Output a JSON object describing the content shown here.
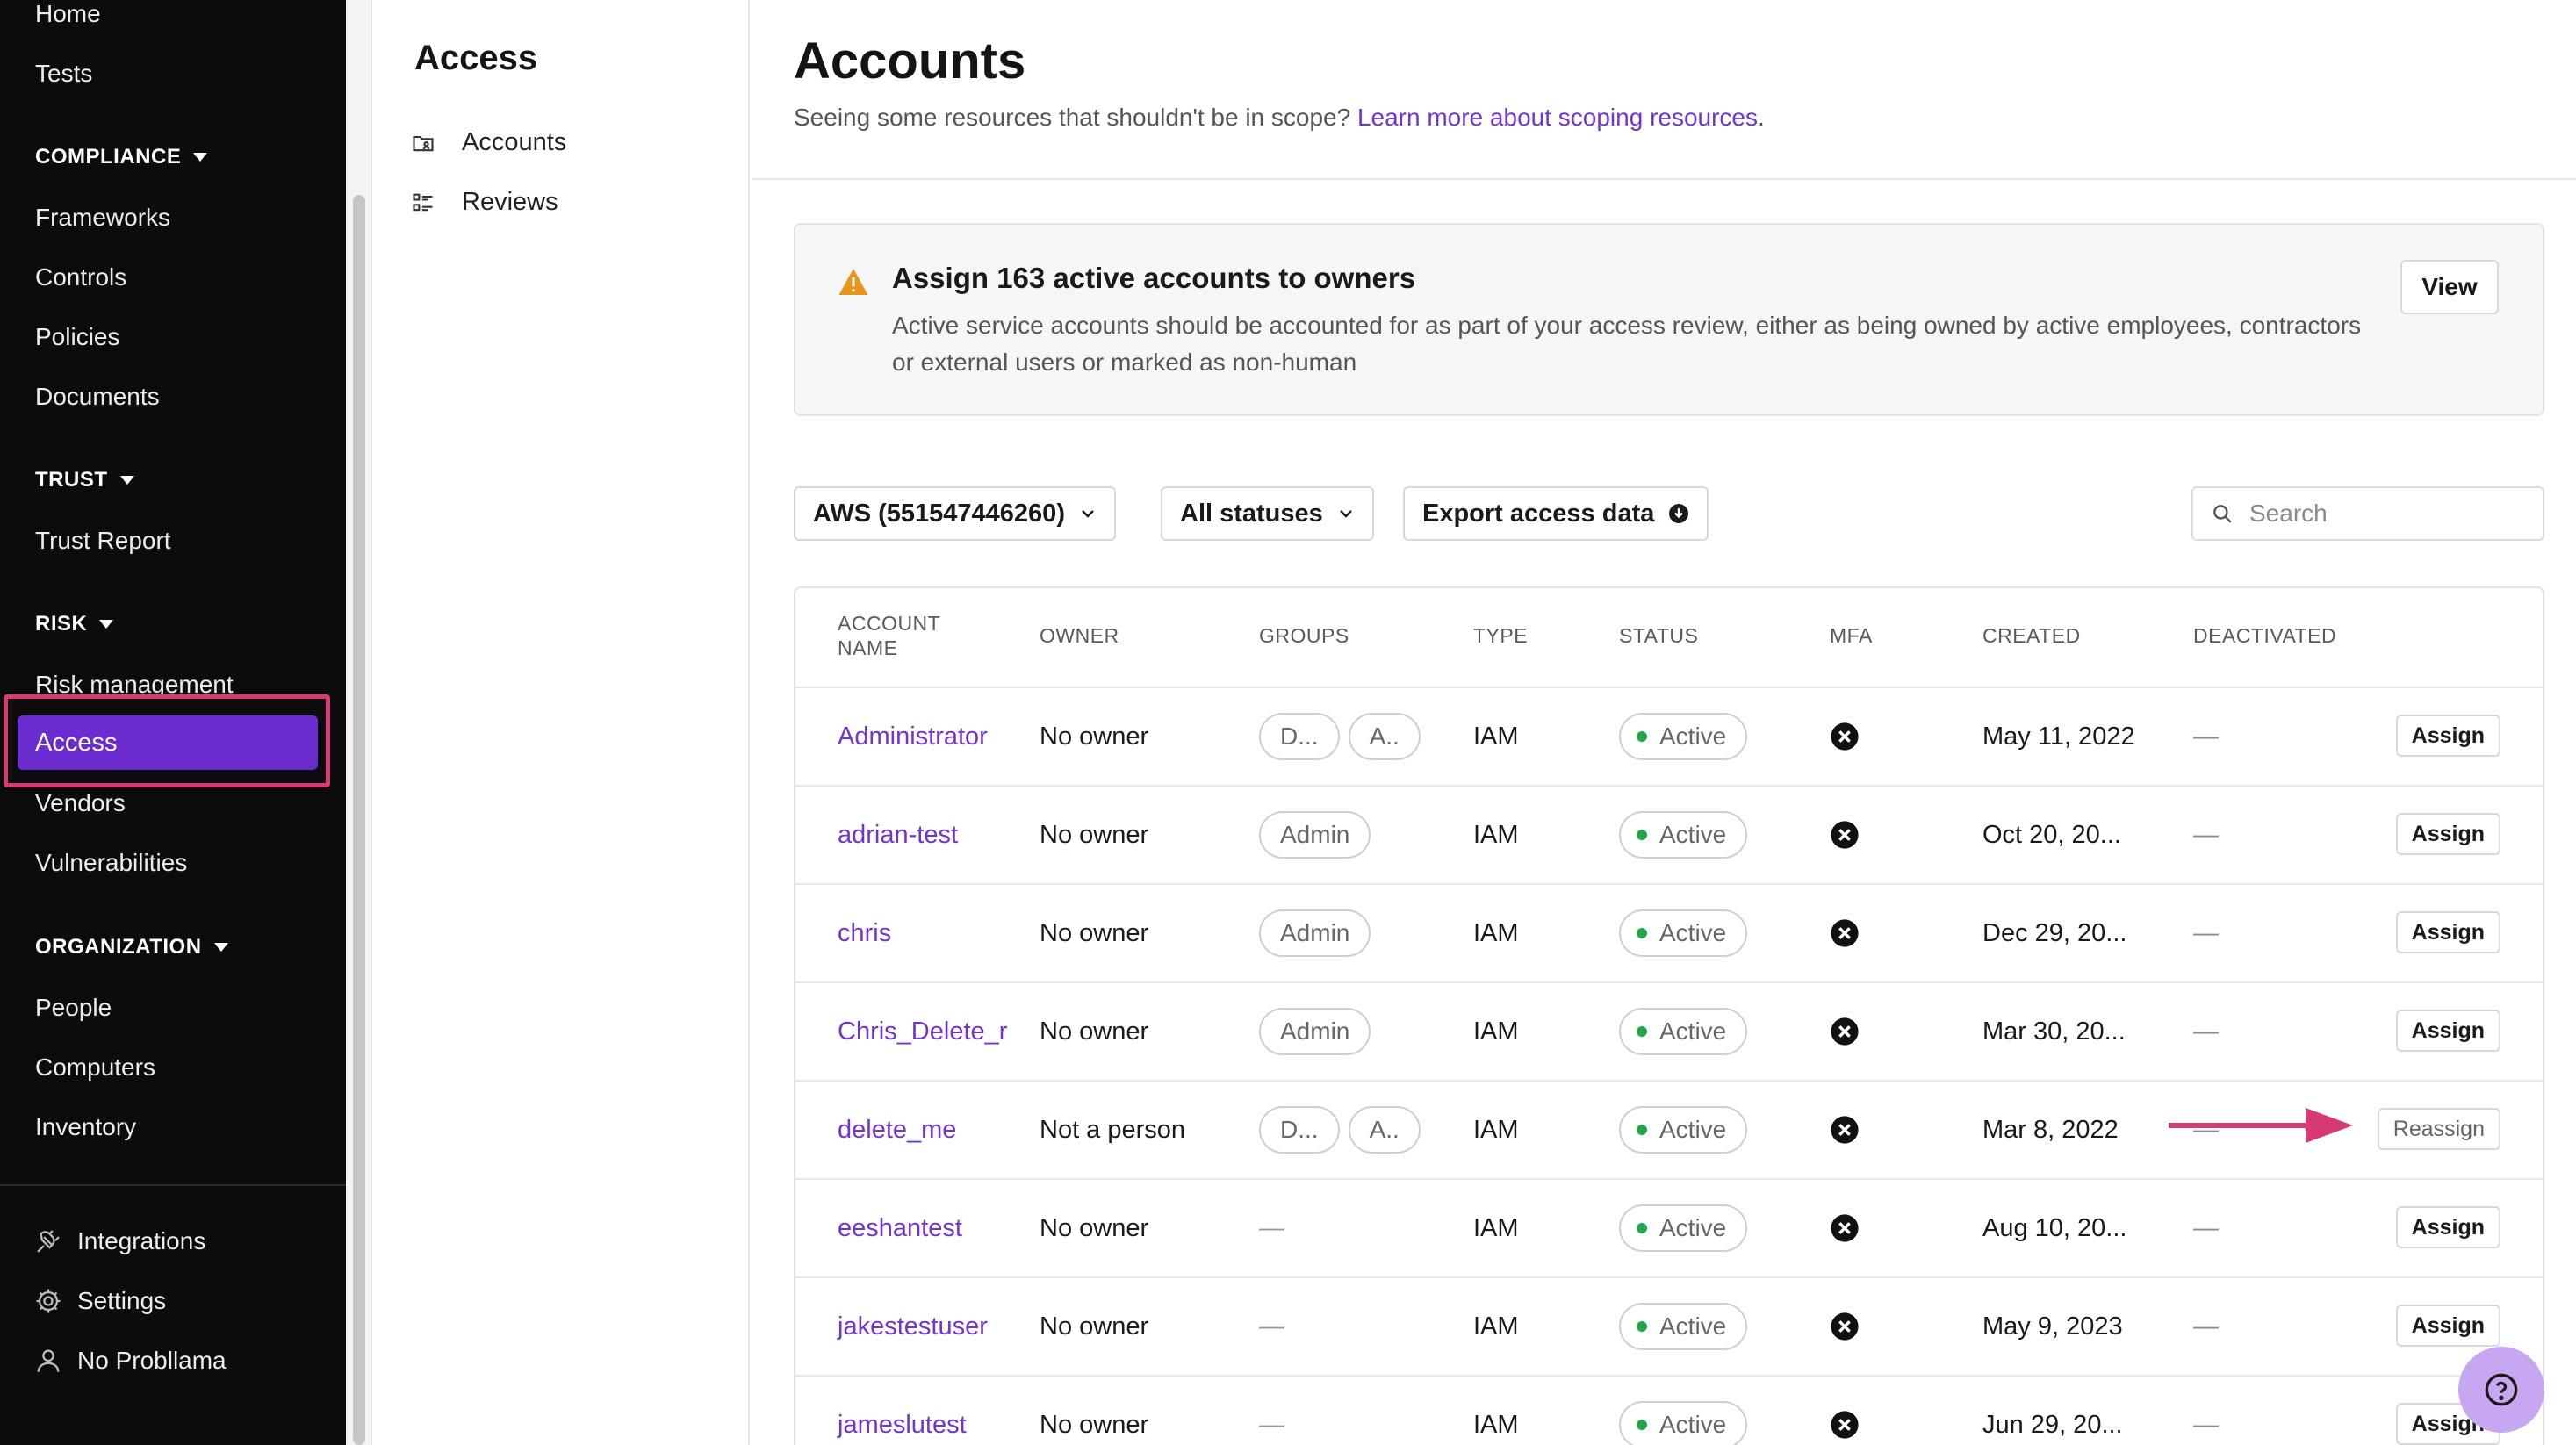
{
  "left_nav": {
    "top_links": [
      "Home",
      "Tests"
    ],
    "sections": [
      {
        "title": "COMPLIANCE",
        "items": [
          "Frameworks",
          "Controls",
          "Policies",
          "Documents"
        ]
      },
      {
        "title": "TRUST",
        "items": [
          "Trust Report"
        ]
      },
      {
        "title": "RISK",
        "items": [
          "Risk management",
          "Access",
          "Vendors",
          "Vulnerabilities"
        ]
      },
      {
        "title": "ORGANIZATION",
        "items": [
          "People",
          "Computers",
          "Inventory"
        ]
      }
    ],
    "active_item": "Access",
    "bottom_links": [
      {
        "label": "Integrations",
        "icon": "plug-icon"
      },
      {
        "label": "Settings",
        "icon": "gear-icon"
      },
      {
        "label": "No Probllama",
        "icon": "user-icon"
      }
    ],
    "accent_color": "#6a2ccf",
    "highlight_color": "#d63b76"
  },
  "sub_nav": {
    "title": "Access",
    "items": [
      {
        "label": "Accounts",
        "icon": "folder-user-icon"
      },
      {
        "label": "Reviews",
        "icon": "checklist-icon"
      }
    ]
  },
  "header": {
    "title": "Accounts",
    "subtitle_prefix": "Seeing some resources that shouldn't be in scope?",
    "subtitle_link": "Learn more about scoping resources",
    "subtitle_suffix": "."
  },
  "banner": {
    "icon": "warning-icon",
    "title": "Assign 163 active accounts to owners",
    "body": "Active service accounts should be accounted for as part of your access review, either as being owned by active employees, contractors or external users or marked as non-human",
    "button": "View"
  },
  "filters": {
    "account_select": "AWS (551547446260)",
    "status_select": "All statuses",
    "export_button": "Export access data",
    "search_placeholder": "Search"
  },
  "table": {
    "headers": {
      "account_name": "ACCOUNT NAME",
      "owner": "OWNER",
      "groups": "GROUPS",
      "type": "TYPE",
      "status": "STATUS",
      "mfa": "MFA",
      "created": "CREATED",
      "deactivated": "DEACTIVATED"
    },
    "rows": [
      {
        "name": "Administrator",
        "owner": "No owner",
        "groups": [
          "D...",
          "A.."
        ],
        "type": "IAM",
        "status": "Active",
        "created": "May 11, 2022",
        "deactivated": "—",
        "action": "Assign"
      },
      {
        "name": "adrian-test",
        "owner": "No owner",
        "groups": [
          "Admin"
        ],
        "type": "IAM",
        "status": "Active",
        "created": "Oct 20, 20...",
        "deactivated": "—",
        "action": "Assign"
      },
      {
        "name": "chris",
        "owner": "No owner",
        "groups": [
          "Admin"
        ],
        "type": "IAM",
        "status": "Active",
        "created": "Dec 29, 20...",
        "deactivated": "—",
        "action": "Assign"
      },
      {
        "name": "Chris_Delete_r",
        "owner": "No owner",
        "groups": [
          "Admin"
        ],
        "type": "IAM",
        "status": "Active",
        "created": "Mar 30, 20...",
        "deactivated": "—",
        "action": "Assign"
      },
      {
        "name": "delete_me",
        "owner": "Not a person",
        "groups": [
          "D...",
          "A.."
        ],
        "type": "IAM",
        "status": "Active",
        "created": "Mar 8, 2022",
        "deactivated": "—",
        "action": "Reassign"
      },
      {
        "name": "eeshantest",
        "owner": "No owner",
        "groups": [],
        "groups_empty": "—",
        "type": "IAM",
        "status": "Active",
        "created": "Aug 10, 20...",
        "deactivated": "—",
        "action": "Assign"
      },
      {
        "name": "jakestestuser",
        "owner": "No owner",
        "groups": [],
        "groups_empty": "—",
        "type": "IAM",
        "status": "Active",
        "created": "May 9, 2023",
        "deactivated": "—",
        "action": "Assign"
      },
      {
        "name": "jameslutest",
        "owner": "No owner",
        "groups": [],
        "groups_empty": "—",
        "type": "IAM",
        "status": "Active",
        "created": "Jun 29, 20...",
        "deactivated": "—",
        "action": "Assign"
      }
    ],
    "mfa_icon": "x-circle-icon",
    "status_color": "#22a84a",
    "link_color": "#7433d1"
  },
  "help_button": {
    "icon": "question-icon",
    "color": "#c7a6f2"
  }
}
